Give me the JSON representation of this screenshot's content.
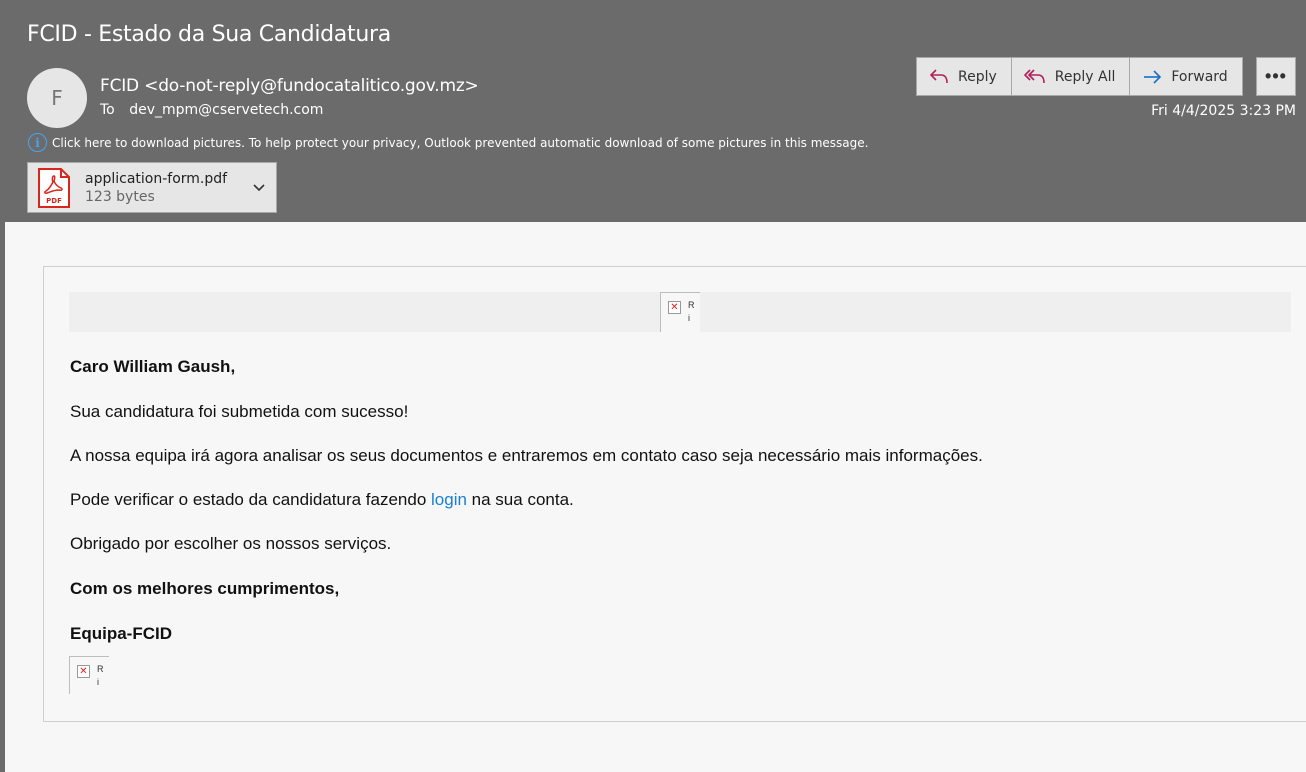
{
  "email": {
    "subject": "FCID - Estado da Sua Candidatura",
    "avatar_initial": "F",
    "sender": "FCID <do-not-reply@fundocatalitico.gov.mz>",
    "to_label": "To",
    "to_address": "dev_mpm@cservetech.com",
    "date": "Fri 4/4/2025 3:23 PM",
    "privacy_notice": "Click here to download pictures. To help protect your privacy, Outlook prevented automatic download of some pictures in this message."
  },
  "actions": {
    "reply": "Reply",
    "reply_all": "Reply All",
    "forward": "Forward",
    "more": "•••"
  },
  "attachment": {
    "name": "application-form.pdf",
    "size": "123 bytes",
    "icon_label": "PDF"
  },
  "body": {
    "greeting": "Caro William Gaush,",
    "line1": "Sua candidatura foi submetida com sucesso!",
    "line2": "A nossa equipa irá agora analisar os seus documentos e entraremos em contato caso seja necessário mais informações.",
    "line3_before": "Pode verificar o estado da candidatura fazendo ",
    "line3_link": "login",
    "line3_after": " na sua conta.",
    "line4": "Obrigado por escolher os nossos serviços.",
    "closing": "Com os melhores cumprimentos,",
    "signature": "Equipa-FCID",
    "broken_image_text_1": "R",
    "broken_image_text_2": "i"
  },
  "colors": {
    "header_bg": "#6b6b6b",
    "reply_icon": "#b0205a",
    "forward_icon": "#1a6fc4",
    "link": "#1a7fd6",
    "pdf_red": "#d9261c"
  }
}
